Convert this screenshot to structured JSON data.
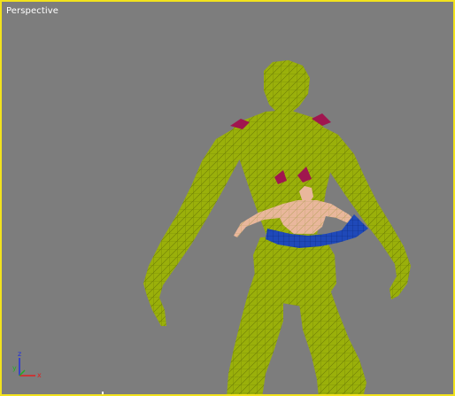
{
  "viewport": {
    "label": "Perspective",
    "border_color": "#f2e21d",
    "background_color": "#7d7d7d"
  },
  "scene": {
    "large_figure": {
      "icon": "wireframe-mannequin-icon",
      "color": "#9ab00a",
      "wire_color": "#6d7e06",
      "accent_color": "#a0164f"
    },
    "small_figure": {
      "icon": "human-figure-icon",
      "color": "#e9b79c"
    },
    "pelvis_mesh": {
      "icon": "wireframe-pelvis-icon",
      "color": "#1f49b9"
    }
  },
  "axis_gizmo": {
    "z_label": "z",
    "y_label": "y",
    "x_label": "x",
    "x_color": "#e02020",
    "y_color": "#20b020",
    "z_color": "#2030e0"
  }
}
